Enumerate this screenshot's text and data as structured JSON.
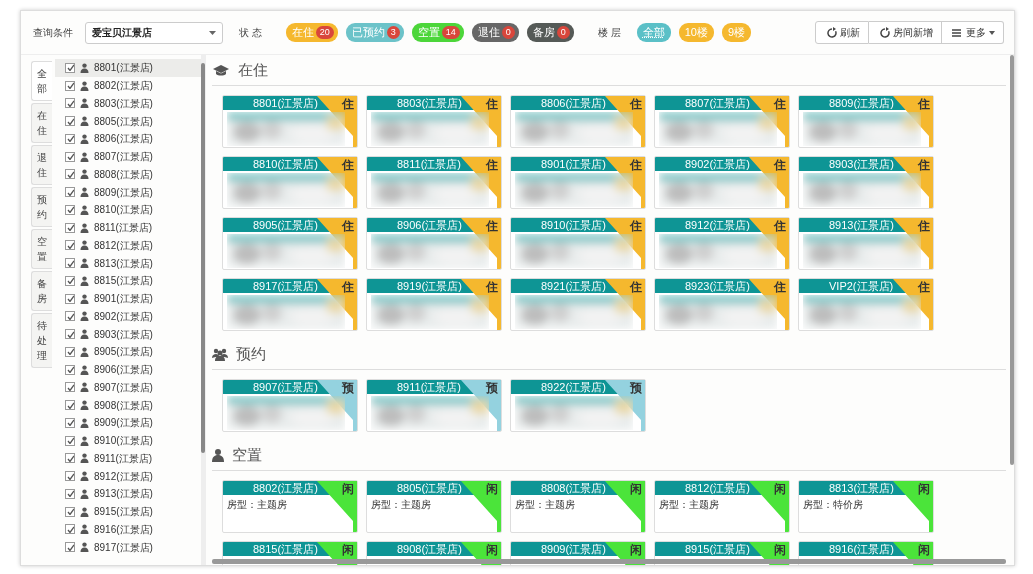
{
  "toolbar": {
    "query_label": "查询条件",
    "store_select": {
      "value": "爱宝贝江景店"
    },
    "status_label": "状 态",
    "status_filters": [
      {
        "label": "在住",
        "count": "20",
        "color": "#f5b82e"
      },
      {
        "label": "已预约",
        "count": "3",
        "color": "#6cc3c9"
      },
      {
        "label": "空置",
        "count": "14",
        "color": "#4cd63a"
      },
      {
        "label": "退住",
        "count": "0",
        "color": "#676767"
      },
      {
        "label": "备房",
        "count": "0",
        "color": "#555a57"
      }
    ],
    "floor_label": "楼 层",
    "floor_filters": [
      {
        "label": "全部",
        "selected": true
      },
      {
        "label": "10楼",
        "selected": false
      },
      {
        "label": "9楼",
        "selected": false
      }
    ],
    "buttons": [
      {
        "label": "刷新"
      },
      {
        "label": "房间新增"
      },
      {
        "label": "更多"
      }
    ]
  },
  "side_tabs": [
    {
      "label": "全部",
      "selected": true
    },
    {
      "label": "在住",
      "selected": false
    },
    {
      "label": "退住",
      "selected": false
    },
    {
      "label": "预约",
      "selected": false
    },
    {
      "label": "空置",
      "selected": false
    },
    {
      "label": "备房",
      "selected": false
    },
    {
      "label": "待处理",
      "selected": false
    }
  ],
  "room_list": [
    {
      "label": "8801(江景店)",
      "checked": true,
      "selected": true
    },
    {
      "label": "8802(江景店)",
      "checked": true,
      "selected": false
    },
    {
      "label": "8803(江景店)",
      "checked": true,
      "selected": false
    },
    {
      "label": "8805(江景店)",
      "checked": true,
      "selected": false
    },
    {
      "label": "8806(江景店)",
      "checked": true,
      "selected": false
    },
    {
      "label": "8807(江景店)",
      "checked": true,
      "selected": false
    },
    {
      "label": "8808(江景店)",
      "checked": true,
      "selected": false
    },
    {
      "label": "8809(江景店)",
      "checked": true,
      "selected": false
    },
    {
      "label": "8810(江景店)",
      "checked": true,
      "selected": false
    },
    {
      "label": "8811(江景店)",
      "checked": true,
      "selected": false
    },
    {
      "label": "8812(江景店)",
      "checked": true,
      "selected": false
    },
    {
      "label": "8813(江景店)",
      "checked": true,
      "selected": false
    },
    {
      "label": "8815(江景店)",
      "checked": true,
      "selected": false
    },
    {
      "label": "8901(江景店)",
      "checked": true,
      "selected": false
    },
    {
      "label": "8902(江景店)",
      "checked": true,
      "selected": false
    },
    {
      "label": "8903(江景店)",
      "checked": true,
      "selected": false
    },
    {
      "label": "8905(江景店)",
      "checked": true,
      "selected": false
    },
    {
      "label": "8906(江景店)",
      "checked": true,
      "selected": false
    },
    {
      "label": "8907(江景店)",
      "checked": true,
      "selected": false
    },
    {
      "label": "8908(江景店)",
      "checked": true,
      "selected": false
    },
    {
      "label": "8909(江景店)",
      "checked": true,
      "selected": false
    },
    {
      "label": "8910(江景店)",
      "checked": true,
      "selected": false
    },
    {
      "label": "8911(江景店)",
      "checked": true,
      "selected": false
    },
    {
      "label": "8912(江景店)",
      "checked": true,
      "selected": false
    },
    {
      "label": "8913(江景店)",
      "checked": true,
      "selected": false
    },
    {
      "label": "8915(江景店)",
      "checked": true,
      "selected": false
    },
    {
      "label": "8916(江景店)",
      "checked": true,
      "selected": false
    },
    {
      "label": "8917(江景店)",
      "checked": true,
      "selected": false
    }
  ],
  "sections": [
    {
      "title": "在住",
      "kind": "occupied",
      "rooms": [
        {
          "name": "8801(江景店)",
          "tag": "住"
        },
        {
          "name": "8803(江景店)",
          "tag": "住"
        },
        {
          "name": "8806(江景店)",
          "tag": "住"
        },
        {
          "name": "8807(江景店)",
          "tag": "住"
        },
        {
          "name": "8809(江景店)",
          "tag": "住"
        },
        {
          "name": "8810(江景店)",
          "tag": "住"
        },
        {
          "name": "8811(江景店)",
          "tag": "住"
        },
        {
          "name": "8901(江景店)",
          "tag": "住"
        },
        {
          "name": "8902(江景店)",
          "tag": "住"
        },
        {
          "name": "8903(江景店)",
          "tag": "住"
        },
        {
          "name": "8905(江景店)",
          "tag": "住"
        },
        {
          "name": "8906(江景店)",
          "tag": "住"
        },
        {
          "name": "8910(江景店)",
          "tag": "住"
        },
        {
          "name": "8912(江景店)",
          "tag": "住"
        },
        {
          "name": "8913(江景店)",
          "tag": "住"
        },
        {
          "name": "8917(江景店)",
          "tag": "住"
        },
        {
          "name": "8919(江景店)",
          "tag": "住"
        },
        {
          "name": "8921(江景店)",
          "tag": "住"
        },
        {
          "name": "8923(江景店)",
          "tag": "住"
        },
        {
          "name": "VIP2(江景店)",
          "tag": "住"
        }
      ]
    },
    {
      "title": "预约",
      "kind": "reserved",
      "rooms": [
        {
          "name": "8907(江景店)",
          "tag": "预"
        },
        {
          "name": "8911(江景店)",
          "tag": "预"
        },
        {
          "name": "8922(江景店)",
          "tag": "预"
        }
      ]
    },
    {
      "title": "空置",
      "kind": "vacant",
      "rooms": [
        {
          "name": "8802(江景店)",
          "tag": "闲",
          "room_type": "房型：主题房"
        },
        {
          "name": "8805(江景店)",
          "tag": "闲",
          "room_type": "房型：主题房"
        },
        {
          "name": "8808(江景店)",
          "tag": "闲",
          "room_type": "房型：主题房"
        },
        {
          "name": "8812(江景店)",
          "tag": "闲",
          "room_type": "房型：主题房"
        },
        {
          "name": "8813(江景店)",
          "tag": "闲",
          "room_type": "房型：特价房"
        },
        {
          "name": "8815(江景店)",
          "tag": "闲"
        },
        {
          "name": "8908(江景店)",
          "tag": "闲"
        },
        {
          "name": "8909(江景店)",
          "tag": "闲"
        },
        {
          "name": "8915(江景店)",
          "tag": "闲"
        },
        {
          "name": "8916(江景店)",
          "tag": "闲"
        }
      ]
    }
  ]
}
